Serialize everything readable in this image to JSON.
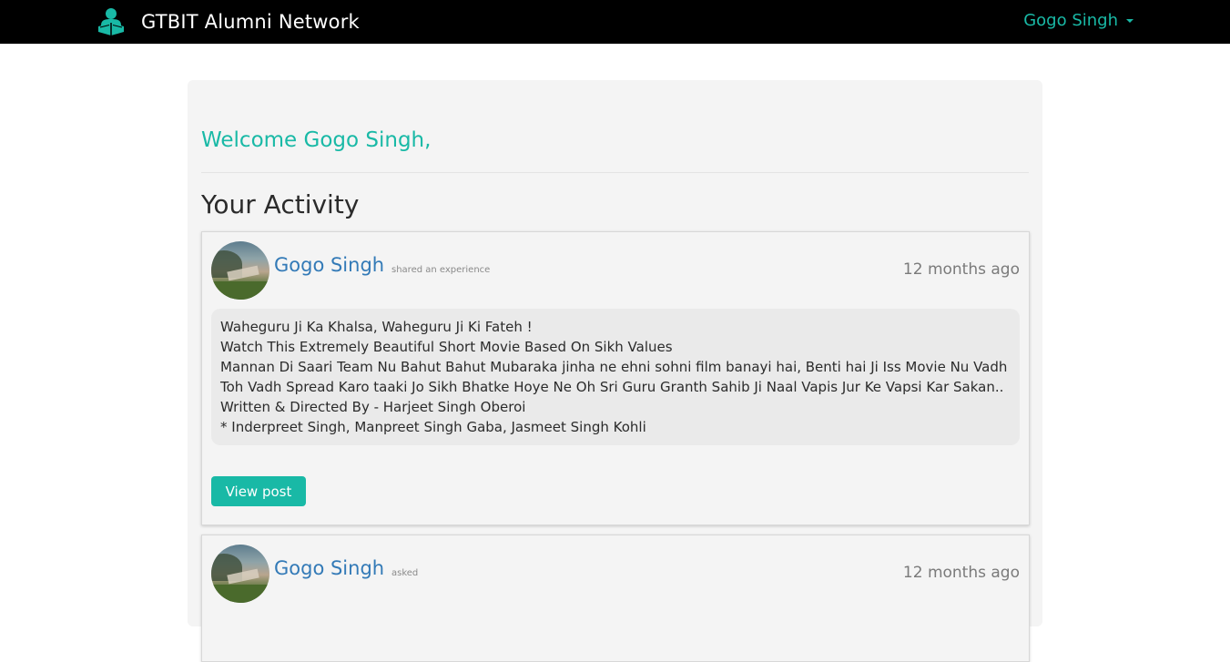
{
  "navbar": {
    "brand_text": "GTBIT Alumni Network",
    "user_name": "Gogo Singh",
    "accent_color": "#19b9a6"
  },
  "main": {
    "welcome": "Welcome Gogo Singh,",
    "section_title": "Your Activity"
  },
  "activities": [
    {
      "author": "Gogo Singh",
      "action": "shared an experience",
      "time": "12 months ago",
      "body_lines": [
        "Waheguru Ji Ka Khalsa, Waheguru Ji Ki Fateh !",
        "Watch This Extremely Beautiful Short Movie Based On Sikh Values",
        "Mannan Di Saari Team Nu Bahut Bahut Mubaraka jinha ne ehni sohni film banayi hai, Benti hai Ji Iss Movie Nu Vadh Toh Vadh Spread Karo taaki Jo Sikh Bhatke Hoye Ne Oh Sri Guru Granth Sahib Ji Naal Vapis Jur Ke Vapsi Kar Sakan..",
        "Written & Directed By - Harjeet Singh Oberoi",
        "* Inderpreet Singh, Manpreet Singh Gaba, Jasmeet Singh Kohli"
      ],
      "button_label": "View post"
    },
    {
      "author": "Gogo Singh",
      "action": "asked",
      "time": "12 months ago"
    }
  ]
}
